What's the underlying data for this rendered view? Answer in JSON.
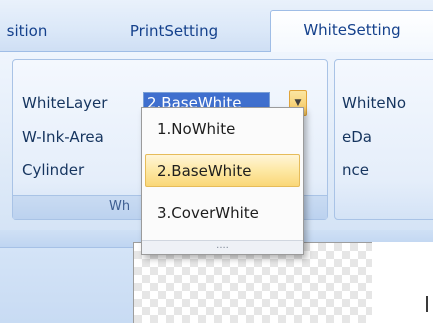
{
  "tabs": {
    "partial": "sition",
    "print": "PrintSetting",
    "white": "WhiteSetting"
  },
  "group1": {
    "white_layer_label": "WhiteLayer",
    "white_layer_value": "2.BaseWhite",
    "w_ink_area_label": "W-Ink-Area",
    "cylinder_label": "Cylinder",
    "group_label": "Wh"
  },
  "group2": {
    "row1": "WhiteNo",
    "row2": "eDa",
    "row3": "nce"
  },
  "dropdown": {
    "options": [
      "1.NoWhite",
      "2.BaseWhite",
      "3.CoverWhite"
    ],
    "selected_index": 1,
    "grip": "...."
  },
  "icons": {
    "combo_arrow": "dropdown-arrow-icon"
  },
  "colors": {
    "selection_blue": "#3f6fce",
    "hover_gold": "#fad778"
  }
}
